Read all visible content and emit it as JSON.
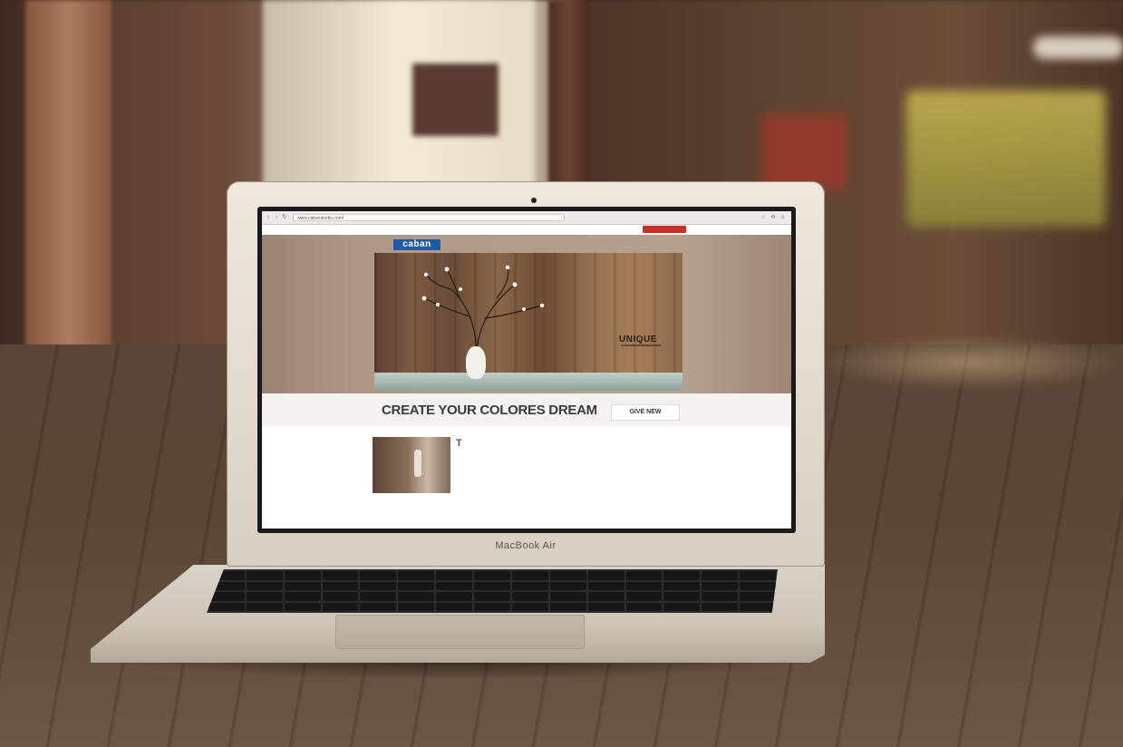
{
  "device": {
    "brand_label": "MacBook Air"
  },
  "browser": {
    "back_glyph": "‹",
    "forward_glyph": "›",
    "reload_glyph": "↻",
    "url": "www.cabanstudio.com/",
    "toolbar_icons": "☆ ⚙ ≡"
  },
  "site": {
    "top_button_label": "",
    "logo": "caban",
    "nav": [
      "",
      "",
      "",
      "",
      "",
      "",
      ""
    ],
    "slide_caption": "UNIQUE",
    "cta_title": "CREATE YOUR COLORES DREAM",
    "cta_button": "GIVE NEW",
    "content": {
      "dropcap": "T",
      "paragraphs": [
        "",
        "",
        ""
      ]
    }
  },
  "colors": {
    "accent_red": "#c8302a",
    "logo_blue": "#1e5aa6"
  },
  "icons": [
    "back-arrow-icon",
    "forward-arrow-icon",
    "reload-icon",
    "star-icon",
    "settings-icon",
    "menu-icon"
  ]
}
